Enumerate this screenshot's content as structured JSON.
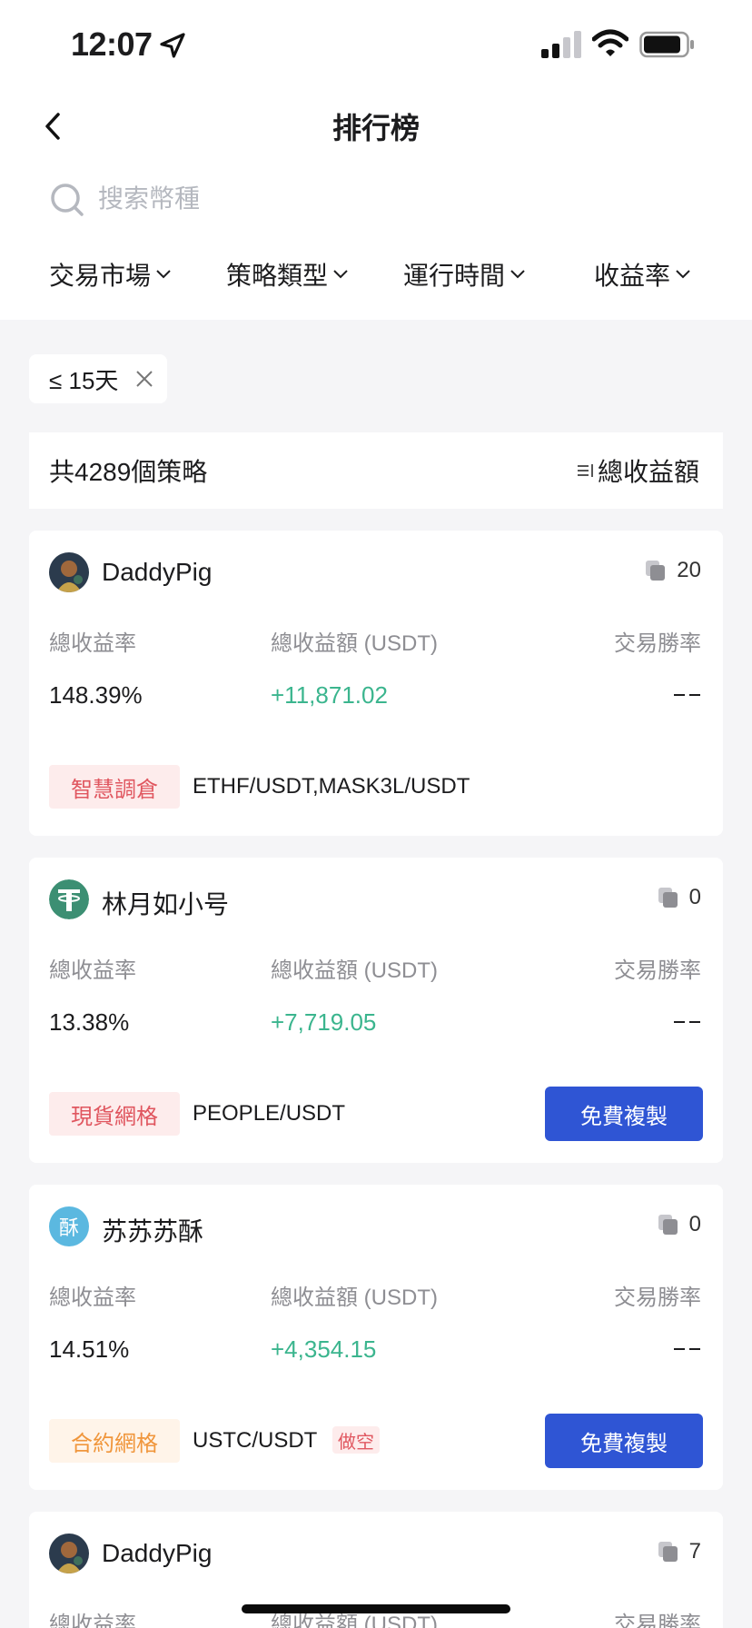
{
  "status_bar": {
    "time": "12:07"
  },
  "header": {
    "title": "排行榜"
  },
  "search": {
    "placeholder": "搜索幣種"
  },
  "filters": [
    {
      "label": "交易市場"
    },
    {
      "label": "策略類型"
    },
    {
      "label": "運行時間"
    },
    {
      "label": "收益率"
    }
  ],
  "active_filter": {
    "label": "≤ 15天"
  },
  "summary": {
    "count_text": "共4289個策略",
    "sort_label": "總收益額"
  },
  "column_labels": {
    "rate": "總收益率",
    "amount": "總收益額 (USDT)",
    "win": "交易勝率"
  },
  "copy_button_label": "免費複製",
  "strategies": [
    {
      "name": "DaddyPig",
      "copies": "20",
      "rate": "148.39%",
      "amount": "+11,871.02",
      "win": "--",
      "type_tag": "智慧調倉",
      "tag_color": "red",
      "pairs": "ETHF/USDT,MASK3L/USDT",
      "has_copy_button": false
    },
    {
      "name": "林月如小号",
      "copies": "0",
      "rate": "13.38%",
      "amount": "+7,719.05",
      "win": "--",
      "type_tag": "現貨網格",
      "tag_color": "red",
      "pairs": "PEOPLE/USDT",
      "has_copy_button": true
    },
    {
      "name": "苏苏苏酥",
      "copies": "0",
      "rate": "14.51%",
      "amount": "+4,354.15",
      "win": "--",
      "type_tag": "合約網格",
      "tag_color": "orange",
      "pairs": "USTC/USDT",
      "short_tag": "做空",
      "avatar_char": "酥",
      "has_copy_button": true
    },
    {
      "name": "DaddyPig",
      "copies": "7"
    }
  ],
  "colors": {
    "accent_blue": "#2f55d4",
    "profit_green": "#3bb58e",
    "tag_red": "#e0565f",
    "tag_orange": "#f0963c"
  }
}
